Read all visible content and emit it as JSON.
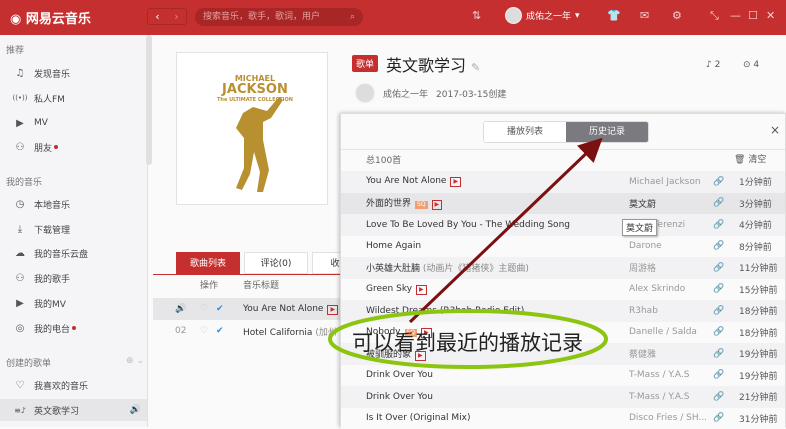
{
  "header": {
    "logo": "网易云音乐",
    "back": "‹",
    "forward": "›",
    "search_placeholder": "搜索音乐，歌手，歌词，用户",
    "username": "成佑之一年"
  },
  "sidebar": {
    "sections": [
      {
        "label": "推荐"
      },
      {
        "label": "我的音乐"
      },
      {
        "label": "创建的歌单"
      }
    ],
    "items": [
      {
        "label": "发现音乐",
        "icon": "♫"
      },
      {
        "label": "私人FM",
        "icon": "((•))"
      },
      {
        "label": "MV",
        "icon": "▶"
      },
      {
        "label": "朋友",
        "icon": "⚇"
      },
      {
        "label": "本地音乐",
        "icon": "◷"
      },
      {
        "label": "下载管理",
        "icon": "⤓"
      },
      {
        "label": "我的音乐云盘",
        "icon": "☁"
      },
      {
        "label": "我的歌手",
        "icon": "⚇"
      },
      {
        "label": "我的MV",
        "icon": "▶"
      },
      {
        "label": "我的电台",
        "icon": "◎"
      },
      {
        "label": "我喜欢的音乐",
        "icon": "♡"
      },
      {
        "label": "英文歌学习",
        "icon": "≡♪"
      }
    ]
  },
  "playlist": {
    "badge": "歌单",
    "title": "英文歌学习",
    "creator": "成佑之一年",
    "created": "2017-03-15创建",
    "song_count": "2",
    "play_count": "4",
    "cover_text": [
      "MICHAEL",
      "JACKSON",
      "The ULTIMATE COLLECTION"
    ],
    "tabs": [
      "歌曲列表",
      "评论(0)",
      "收藏者"
    ],
    "columns": [
      "操作",
      "音乐标题"
    ],
    "songs": [
      {
        "no": "",
        "title": "You Are Not Alone",
        "extra": ""
      },
      {
        "no": "02",
        "title": "Hotel California",
        "extra": "(加州"
      }
    ]
  },
  "panel": {
    "tabs": [
      "播放列表",
      "历史记录"
    ],
    "close": "×",
    "total": "总100首",
    "clear": "清空",
    "rows": [
      {
        "title": "You Are Not Alone",
        "sub": "",
        "mv": true,
        "sq": false,
        "artist": "Michael Jackson",
        "time": "1分钟前"
      },
      {
        "title": "外面的世界",
        "sub": "",
        "mv": true,
        "sq": true,
        "artist": "莫文蔚",
        "time": "3分钟前"
      },
      {
        "title": "Love To Be Loved By You - The Wedding Song",
        "sub": "",
        "mv": false,
        "sq": false,
        "artist": "Marc Terenzi",
        "time": "4分钟前"
      },
      {
        "title": "Home Again",
        "sub": "",
        "mv": false,
        "sq": false,
        "artist": "Darone",
        "time": "8分钟前"
      },
      {
        "title": "小英雄大肚腩",
        "sub": " (动画片《猪猪侠》主题曲)",
        "mv": false,
        "sq": false,
        "artist": "周游格",
        "time": "11分钟前"
      },
      {
        "title": "Green Sky",
        "sub": "",
        "mv": true,
        "sq": false,
        "artist": "Alex Skrindo",
        "time": "15分钟前"
      },
      {
        "title": "Wildest Dreams (R3hab Radio Edit)",
        "sub": "",
        "mv": false,
        "sq": false,
        "artist": "R3hab",
        "time": "18分钟前"
      },
      {
        "title": "Nobody",
        "sub": "",
        "mv": true,
        "sq": true,
        "artist": "Danelle / Salda",
        "time": "18分钟前"
      },
      {
        "title": "被驯服的象",
        "sub": "",
        "mv": true,
        "sq": false,
        "artist": "蔡健雅",
        "time": "19分钟前"
      },
      {
        "title": "Drink Over You",
        "sub": "",
        "mv": false,
        "sq": false,
        "artist": "T-Mass / Y.A.S",
        "time": "19分钟前"
      },
      {
        "title": "Drink Over You",
        "sub": "",
        "mv": false,
        "sq": false,
        "artist": "T-Mass / Y.A.S",
        "time": "21分钟前"
      },
      {
        "title": "Is It Over (Original Mix)",
        "sub": "",
        "mv": false,
        "sq": false,
        "artist": "Disco Fries / SH...",
        "time": "31分钟前"
      }
    ],
    "tooltip": "莫文蔚",
    "mv_label": "▶",
    "sq_label": "SQ"
  },
  "annotation": {
    "text": "可以看到最近的播放记录",
    "arrow_color": "#7a1010",
    "ellipse_color": "#8cc510"
  }
}
